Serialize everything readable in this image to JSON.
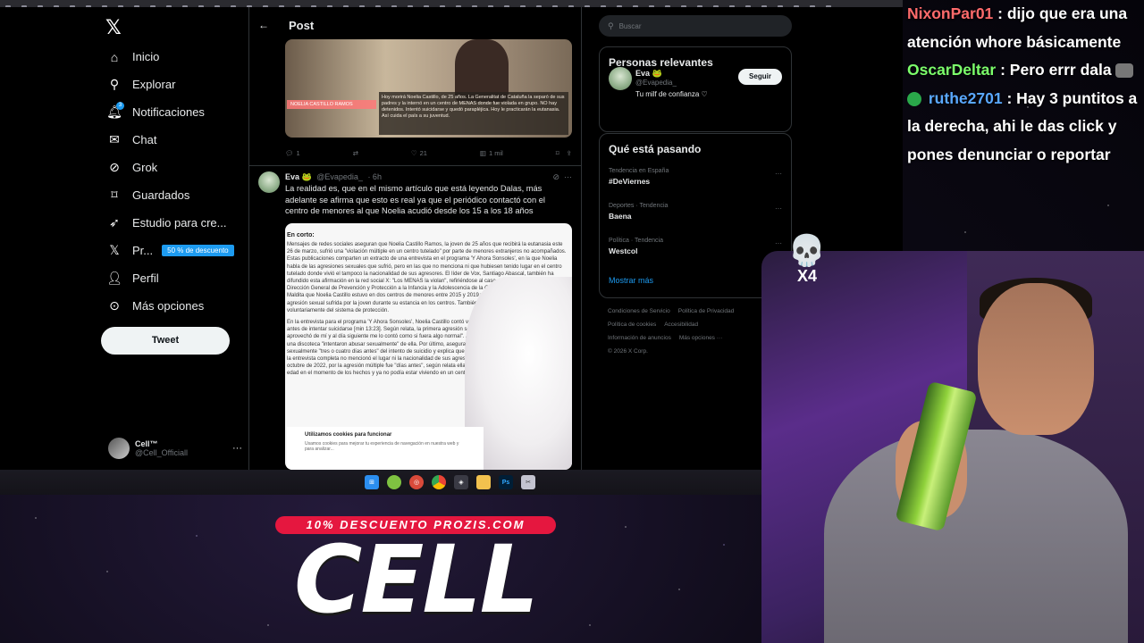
{
  "x_app": {
    "nav": [
      {
        "label": "Inicio",
        "icon": "home-icon"
      },
      {
        "label": "Explorar",
        "icon": "search-icon"
      },
      {
        "label": "Notificaciones",
        "icon": "bell-icon",
        "badge": "3"
      },
      {
        "label": "Chat",
        "icon": "mail-icon"
      },
      {
        "label": "Grok",
        "icon": "grok-icon"
      },
      {
        "label": "Guardados",
        "icon": "bookmark-icon"
      },
      {
        "label": "Estudio para cre...",
        "icon": "rocket-icon"
      },
      {
        "label": "Pr...",
        "icon": "x-premium-icon",
        "promo": "50 % de descuento"
      },
      {
        "label": "Perfil",
        "icon": "user-icon"
      },
      {
        "label": "Más opciones",
        "icon": "more-circle-icon"
      }
    ],
    "tweet_button": "Tweet",
    "account": {
      "name": "Cell™",
      "handle": "@Cell_Officiall"
    },
    "header": {
      "title": "Post"
    },
    "media_caption": {
      "lower_third": "NOELIA CASTILLO RAMOS",
      "text": "Hoy morirá Noelia Castillo, de 25 años. La Generalitat de Cataluña la separó de sus padres y la internó en un centro de MENAS donde fue violada en grupo. NO hay detenidos. Intentó suicidarse y quedó parapléjica. Hoy le practicarán la eutanasia. Así cuida el país a su juventud."
    },
    "post1_actions": {
      "replies": "1",
      "retweets": "",
      "likes": "21",
      "views": "1 mil"
    },
    "reply": {
      "name": "Eva 🐸",
      "handle": "@Evapedia_",
      "time": "· 6h",
      "text": "La realidad es, que en el mismo artículo que está leyendo Dalas, más adelante se afirma que esto es real ya que el periódico contactó con el centro de menores al que Noelia acudió desde los 15 a los 18 años"
    },
    "article": {
      "heading": "En corto:",
      "p1": "Mensajes de redes sociales aseguran que Noelia Castillo Ramos, la joven de 25 años que recibirá la eutanasia este 26 de marzo, sufrió una \"violación múltiple en un centro tutelado\" por parte de menores extranjeros no acompañados. Estas publicaciones comparten un extracto de una entrevista en el programa 'Y Ahora Sonsoles', en la que Noelia habla de las agresiones sexuales que sufrió, pero en las que no menciona ni que hubiesen tenido lugar en el centro tutelado donde vivió el tampoco la nacionalidad de sus agresores. El líder de Vox, Santiago Abascal, también ha difundido esta afirmación en la red social X: \"Los MENAS la violan\", refiriéndose al caso de Noelia Castillo. Desde la Dirección General de Prevención y Protección a la Infancia y la Adolescencia de la Generalitat de Cataluña afirman a Maldita que Noelia Castillo estuvo en dos centros de menores entre 2015 y 2019 y que no tienen registro de ninguna agresión sexual sufrida por la joven durante su estancia en los centros. También aseguran que a los 18 años salió voluntariamente del sistema de protección.",
      "p2": "En la entrevista para el programa 'Y Ahora Sonsoles', Noelia Castillo contó varios episodios traumáticos que vivió antes de intentar suicidarse [min 13:23]. Según relata, la primera agresión sexual fue por parte de su exnovio: \"Se aprovechó de mí y al día siguiente me lo contó como si fuera algo normal\". A continuación, afirma que dos chicos en una discoteca \"intentaron abusar sexualmente\" de ella. Por último, asegura que \"tres chicos a la vez\" abusaron de ella sexualmente \"tres o cuatro días antes\" del intento de suicidio y explica que no denunció los hechos ante la Policía. En la entrevista completa no mencionó el lugar ni la nacionalidad de sus agresores. Noelia intentó suicidarse el 4 de octubre de 2022, por la agresión múltiple fue \"días antes\", según relata ella en la entrevista, la joven era mayor de edad en el momento de los hechos y ya no podía estar viviendo en un centro de menores.",
      "cookie_title": "Utilizamos cookies para funcionar",
      "cookie_sub": "Usamos cookies para mejorar tu experiencia de navegación en nuestra web y para analizar..."
    },
    "search": {
      "placeholder": "Buscar"
    },
    "relevant": {
      "title": "Personas relevantes",
      "name": "Eva 🐸",
      "handle": "@Evapedia_",
      "bio": "Tu milf de confianza ♡",
      "follow": "Seguir"
    },
    "trends": {
      "title": "Qué está pasando",
      "items": [
        {
          "context": "Tendencia en España",
          "name": "#DeViernes"
        },
        {
          "context": "Deportes · Tendencia",
          "name": "Baena"
        },
        {
          "context": "Política · Tendencia",
          "name": "Westcol"
        }
      ],
      "show_more": "Mostrar más"
    },
    "footer": [
      "Condiciones de Servicio",
      "Política de Privacidad",
      "Política de cookies",
      "Accesibilidad",
      "Información de anuncios",
      "Más opciones ···",
      "© 2026 X Corp."
    ]
  },
  "taskbar": {
    "icons": [
      "windows-start-icon",
      "chat-app-icon",
      "settings-app-icon",
      "chrome-icon",
      "app-icon",
      "folder-icon",
      "photoshop-icon",
      "snip-icon"
    ],
    "photoshop_label": "Ps"
  },
  "chat": [
    {
      "user": "NixonPar01",
      "message": ": dijo que era una atención whore básicamente"
    },
    {
      "user": "OscarDeltar",
      "message": ": Pero errr dala"
    },
    {
      "user": "ruthe2701",
      "message": ": Hay 3 puntitos a la derecha, ahi le das click y pones denunciar o reportar"
    }
  ],
  "overlay": {
    "multiplier": "X4",
    "skull": "💀"
  },
  "branding": {
    "promo": "10% DESCUENTO PROZIS.COM",
    "logo": "CELL"
  }
}
